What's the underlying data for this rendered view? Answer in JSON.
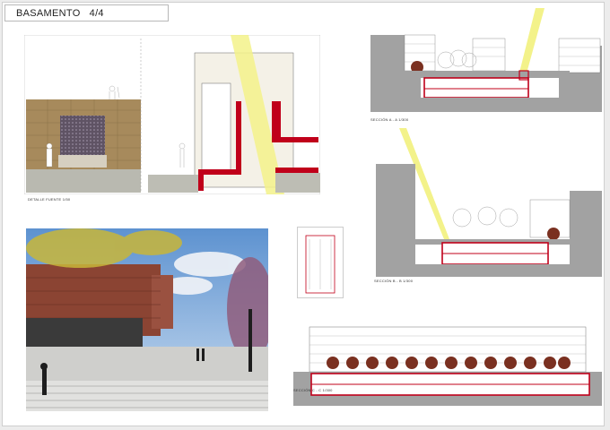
{
  "sheet": {
    "title": "BASAMENTO",
    "page": "4/4"
  },
  "captions": {
    "detail": "DETALLE FUENTE 1/50",
    "section_aa": "SECCIÓN A - A  1/300",
    "section_bb": "SECCIÓN B - B  1/300",
    "section_cc": "SECCIÓN C - C  1/300"
  },
  "colors": {
    "accent_red": "#c0001a",
    "ground_gray": "#8c8c8c",
    "light_beam": "#f3f28a",
    "sky_blue": "#6d9fd6"
  }
}
